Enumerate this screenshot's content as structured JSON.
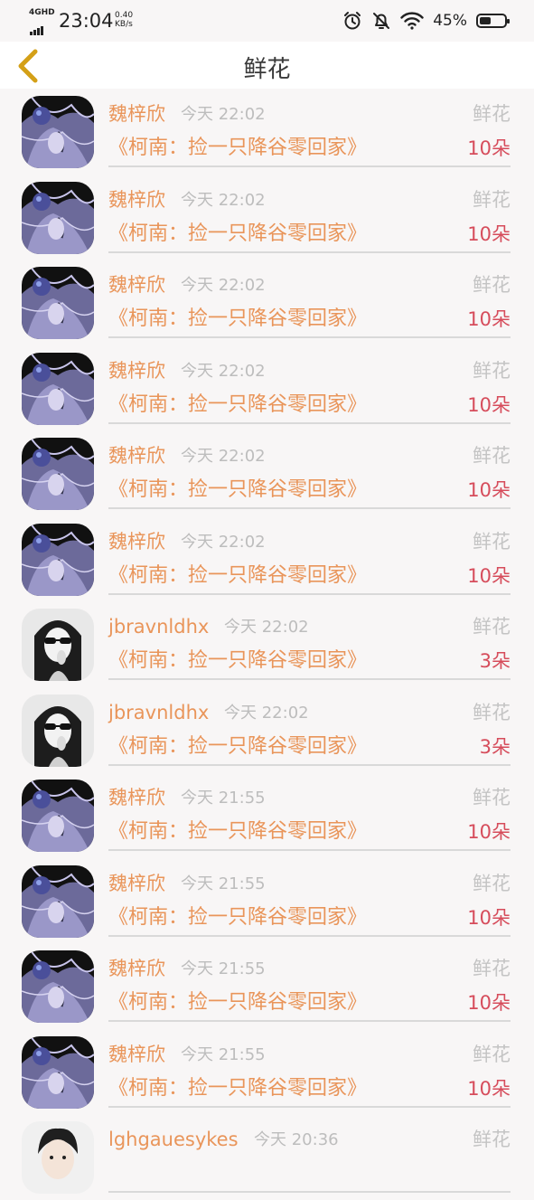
{
  "status_bar": {
    "network": "4GHD",
    "time": "23:04",
    "speed_value": "0.40",
    "speed_unit": "KB/s",
    "battery_text": "45%",
    "battery_level": 0.45
  },
  "header": {
    "title": "鲜花",
    "back_icon": "chevron-left-icon",
    "back_color": "#d4a017"
  },
  "colors": {
    "accent_orange": "#e9955a",
    "count_red": "#d64c5b",
    "muted_gray": "#bdbdbd"
  },
  "records": [
    {
      "user": "魏梓欣",
      "avatar": "anime",
      "time": "今天 22:02",
      "type": "鲜花",
      "book": "《柯南：捡一只降谷零回家》",
      "count": "10朵"
    },
    {
      "user": "魏梓欣",
      "avatar": "anime",
      "time": "今天 22:02",
      "type": "鲜花",
      "book": "《柯南：捡一只降谷零回家》",
      "count": "10朵"
    },
    {
      "user": "魏梓欣",
      "avatar": "anime",
      "time": "今天 22:02",
      "type": "鲜花",
      "book": "《柯南：捡一只降谷零回家》",
      "count": "10朵"
    },
    {
      "user": "魏梓欣",
      "avatar": "anime",
      "time": "今天 22:02",
      "type": "鲜花",
      "book": "《柯南：捡一只降谷零回家》",
      "count": "10朵"
    },
    {
      "user": "魏梓欣",
      "avatar": "anime",
      "time": "今天 22:02",
      "type": "鲜花",
      "book": "《柯南：捡一只降谷零回家》",
      "count": "10朵"
    },
    {
      "user": "魏梓欣",
      "avatar": "anime",
      "time": "今天 22:02",
      "type": "鲜花",
      "book": "《柯南：捡一只降谷零回家》",
      "count": "10朵"
    },
    {
      "user": "jbravnldhx",
      "avatar": "photo-girl",
      "time": "今天 22:02",
      "type": "鲜花",
      "book": "《柯南：捡一只降谷零回家》",
      "count": "3朵"
    },
    {
      "user": "jbravnldhx",
      "avatar": "photo-girl",
      "time": "今天 22:02",
      "type": "鲜花",
      "book": "《柯南：捡一只降谷零回家》",
      "count": "3朵"
    },
    {
      "user": "魏梓欣",
      "avatar": "anime",
      "time": "今天 21:55",
      "type": "鲜花",
      "book": "《柯南：捡一只降谷零回家》",
      "count": "10朵"
    },
    {
      "user": "魏梓欣",
      "avatar": "anime",
      "time": "今天 21:55",
      "type": "鲜花",
      "book": "《柯南：捡一只降谷零回家》",
      "count": "10朵"
    },
    {
      "user": "魏梓欣",
      "avatar": "anime",
      "time": "今天 21:55",
      "type": "鲜花",
      "book": "《柯南：捡一只降谷零回家》",
      "count": "10朵"
    },
    {
      "user": "魏梓欣",
      "avatar": "anime",
      "time": "今天 21:55",
      "type": "鲜花",
      "book": "《柯南：捡一只降谷零回家》",
      "count": "10朵"
    },
    {
      "user": "lghgauesykes",
      "avatar": "photo-boy",
      "time": "今天 20:36",
      "type": "鲜花",
      "book": "",
      "count": ""
    }
  ]
}
